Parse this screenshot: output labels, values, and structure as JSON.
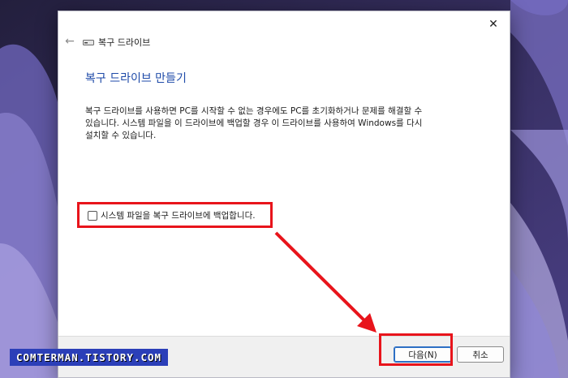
{
  "colors": {
    "accent": "#1e4aa8",
    "highlight": "#e8141b",
    "watermark_bg": "#2b3fb8"
  },
  "window": {
    "nav_title": "복구 드라이브",
    "close_icon": "close-icon",
    "back_icon": "back-arrow-icon",
    "drive_icon": "drive-icon"
  },
  "main": {
    "heading": "복구 드라이브 만들기",
    "description": "복구 드라이브를 사용하면 PC를 시작할 수 없는 경우에도 PC를 초기화하거나 문제를 해결할 수\n있습니다. 시스템 파일을 이 드라이브에 백업할 경우 이 드라이브를 사용하여 Windows를 다시\n설치할 수 있습니다.",
    "checkbox_label": "시스템 파일을 복구 드라이브에 백업합니다.",
    "checkbox_checked": false
  },
  "footer": {
    "next_label": "다음(N)",
    "cancel_label": "취소"
  },
  "watermark": "COMTERMAN.TISTORY.COM"
}
